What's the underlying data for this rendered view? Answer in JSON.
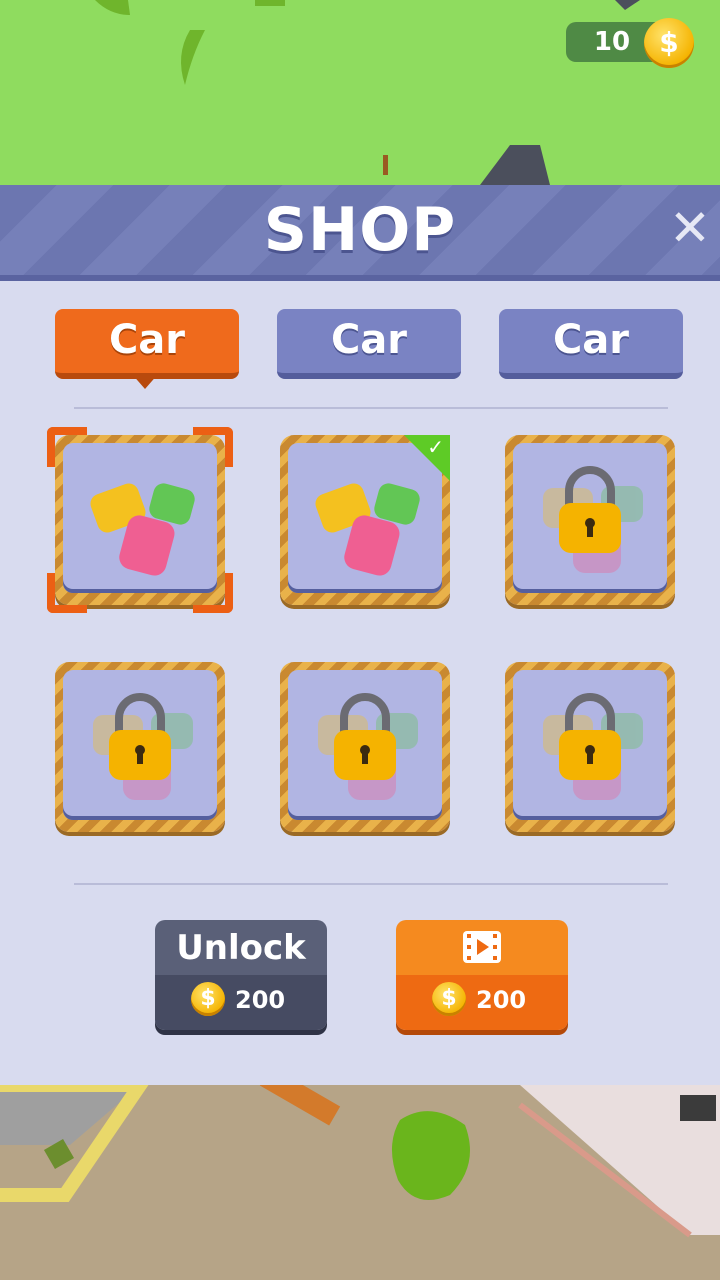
{
  "hud": {
    "coins": "10",
    "coin_symbol": "$"
  },
  "shop": {
    "title": "SHOP",
    "close_glyph": "✕",
    "tabs": [
      {
        "label": "Car",
        "active": true
      },
      {
        "label": "Car",
        "active": false
      },
      {
        "label": "Car",
        "active": false
      }
    ],
    "items": [
      {
        "state": "selected",
        "icon": "cars-pile-icon"
      },
      {
        "state": "owned",
        "icon": "cars-pile-icon",
        "check": "✓"
      },
      {
        "state": "locked",
        "icon": "padlock-icon"
      },
      {
        "state": "locked",
        "icon": "padlock-icon"
      },
      {
        "state": "locked",
        "icon": "padlock-icon"
      },
      {
        "state": "locked",
        "icon": "padlock-icon"
      }
    ],
    "unlock_button": {
      "label": "Unlock",
      "price": "200"
    },
    "ad_button": {
      "price": "200",
      "icon": "video-icon"
    }
  },
  "colors": {
    "accent": "#ef6a1c",
    "header": "#6c76b0",
    "owned_badge": "#5ecb26",
    "coin": "#f5b300"
  }
}
